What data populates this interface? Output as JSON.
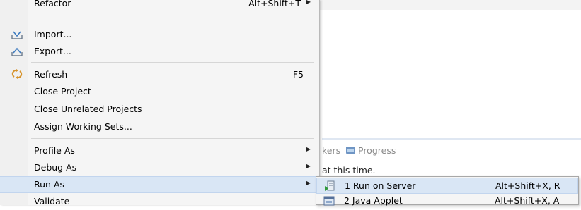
{
  "background": {
    "tabs": {
      "markers_partial": "kers",
      "progress": "Progress"
    },
    "message_partial": "at this time."
  },
  "menu": {
    "items": [
      {
        "label": "Refactor",
        "accel": "Alt+Shift+T"
      },
      {
        "label": "Import...",
        "icon": "import-icon"
      },
      {
        "label": "Export...",
        "icon": "export-icon"
      },
      {
        "label": "Refresh",
        "accel": "F5",
        "icon": "refresh-icon"
      },
      {
        "label": "Close Project"
      },
      {
        "label": "Close Unrelated Projects"
      },
      {
        "label": "Assign Working Sets..."
      },
      {
        "label": "Profile As"
      },
      {
        "label": "Debug As"
      },
      {
        "label": "Run As",
        "selected": true
      },
      {
        "label": "Validate"
      }
    ]
  },
  "submenu": {
    "items": [
      {
        "label": "1 Run on Server",
        "accel": "Alt+Shift+X, R",
        "icon": "run-on-server-icon",
        "selected": true
      },
      {
        "label": "2 Java Applet",
        "accel": "Alt+Shift+X, A",
        "icon": "java-applet-icon"
      }
    ]
  },
  "colors": {
    "selection": "#d9e6f5",
    "menu_bg": "#f5f5f5"
  }
}
